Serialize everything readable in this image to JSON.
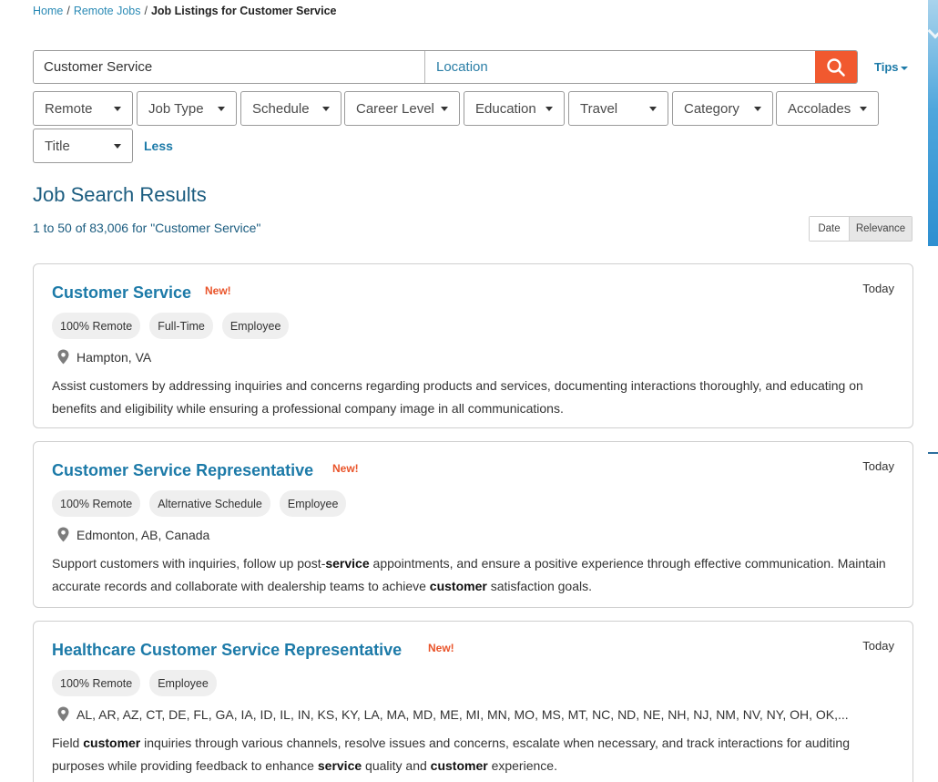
{
  "breadcrumb": {
    "home": "Home",
    "remote_jobs": "Remote Jobs",
    "current": "Job Listings for Customer Service",
    "separator": "/"
  },
  "search": {
    "query": "Customer Service",
    "location_placeholder": "Location",
    "button_icon": "search-icon",
    "tips_label": "Tips"
  },
  "filters": {
    "remote": "Remote",
    "job_type": "Job Type",
    "schedule": "Schedule",
    "career_level": "Career Level",
    "education": "Education",
    "travel": "Travel",
    "category": "Category",
    "accolades": "Accolades",
    "title": "Title",
    "less_label": "Less"
  },
  "results": {
    "heading": "Job Search Results",
    "count_text": "1 to 50 of 83,006 for \"Customer Service\"",
    "sort": {
      "date": "Date",
      "relevance": "Relevance",
      "active": "Relevance"
    }
  },
  "jobs": [
    {
      "title": "Customer Service",
      "badge": "New!",
      "posted": "Today",
      "tags": [
        "100% Remote",
        "Full-Time",
        "Employee"
      ],
      "location": "Hampton, VA",
      "description": "Assist customers by addressing inquiries and concerns regarding products and services, documenting interactions thoroughly, and educating on benefits and eligibility while ensuring a professional company image in all communications."
    },
    {
      "title": "Customer Service Representative",
      "badge": "New!",
      "posted": "Today",
      "tags": [
        "100% Remote",
        "Alternative Schedule",
        "Employee"
      ],
      "location": "Edmonton, AB, Canada",
      "description_parts": [
        "Support customers with inquiries, follow up post-",
        "service",
        " appointments, and ensure a positive experience through effective communication. Maintain accurate records and collaborate with dealership teams to achieve ",
        "customer",
        " satisfaction goals."
      ]
    },
    {
      "title": "Healthcare Customer Service Representative",
      "badge": "New!",
      "posted": "Today",
      "tags": [
        "100% Remote",
        "Employee"
      ],
      "location": "AL, AR, AZ, CT, DE, FL, GA, IA, ID, IL, IN, KS, KY, LA, MA, MD, ME, MI, MN, MO, MS, MT, NC, ND, NE, NH, NJ, NM, NV, NY, OH, OK,...",
      "description_parts": [
        "Field ",
        "customer",
        " inquiries through various channels, resolve issues and concerns, escalate when necessary, and track interactions for auditing purposes while providing feedback to enhance ",
        "service",
        " quality and ",
        "customer",
        " experience."
      ]
    }
  ],
  "colors": {
    "accent_blue": "#1c7aa8",
    "heading_blue": "#1c5d80",
    "search_orange": "#f1592f",
    "new_badge": "#e9542a"
  }
}
